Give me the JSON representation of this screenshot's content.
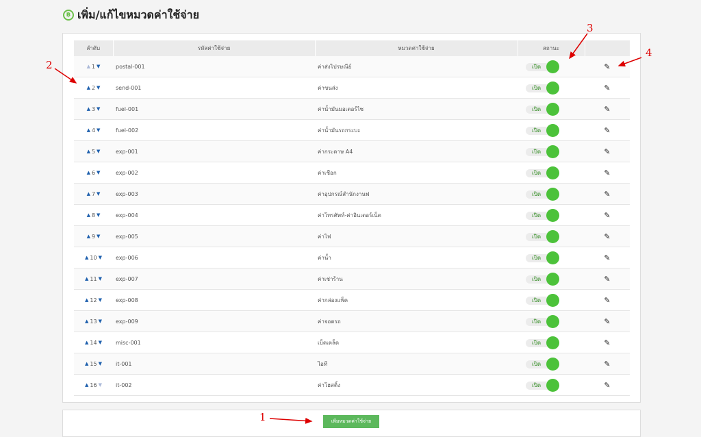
{
  "page": {
    "title": "เพิ่ม/แก้ไขหมวดค่าใช้จ่าย",
    "title_icon": "coin-icon"
  },
  "table": {
    "headers": {
      "order": "ลำดับ",
      "code": "รหัสค่าใช้จ่าย",
      "category": "หมวดค่าใช้จ่าย",
      "status": "สถานะ",
      "action": ""
    },
    "rows": [
      {
        "order": "1",
        "code": "postal-001",
        "category": "ค่าส่งไปรษณีย์",
        "status": "เปิด"
      },
      {
        "order": "2",
        "code": "send-001",
        "category": "ค่าขนส่ง",
        "status": "เปิด"
      },
      {
        "order": "3",
        "code": "fuel-001",
        "category": "ค่าน้ำมันมอเตอร์ไซ",
        "status": "เปิด"
      },
      {
        "order": "4",
        "code": "fuel-002",
        "category": "ค่าน้ำมันรถกระบะ",
        "status": "เปิด"
      },
      {
        "order": "5",
        "code": "exp-001",
        "category": "ค่ากระดาษ A4",
        "status": "เปิด"
      },
      {
        "order": "6",
        "code": "exp-002",
        "category": "ค่าเชือก",
        "status": "เปิด"
      },
      {
        "order": "7",
        "code": "exp-003",
        "category": "ค่าอุปกรณ์สำนักงานฟ",
        "status": "เปิด"
      },
      {
        "order": "8",
        "code": "exp-004",
        "category": "ค่าโทรศัพท์-ค่าอินเตอร์เน็ต",
        "status": "เปิด"
      },
      {
        "order": "9",
        "code": "exp-005",
        "category": "ค่าไฟ",
        "status": "เปิด"
      },
      {
        "order": "10",
        "code": "exp-006",
        "category": "ค่าน้ำ",
        "status": "เปิด"
      },
      {
        "order": "11",
        "code": "exp-007",
        "category": "ค่าเช่าร้าน",
        "status": "เปิด"
      },
      {
        "order": "12",
        "code": "exp-008",
        "category": "ค่ากล่องแพ็ค",
        "status": "เปิด"
      },
      {
        "order": "13",
        "code": "exp-009",
        "category": "ค่าจอดรถ",
        "status": "เปิด"
      },
      {
        "order": "14",
        "code": "misc-001",
        "category": "เบ็ดเตล็ด",
        "status": "เปิด"
      },
      {
        "order": "15",
        "code": "it-001",
        "category": "ไอที",
        "status": "เปิด"
      },
      {
        "order": "16",
        "code": "it-002",
        "category": "ค่าโฮสติ้ง",
        "status": "เปิด"
      }
    ]
  },
  "footer": {
    "add_button": "เพิ่มหมวดค่าใช้จ่าย"
  },
  "annotations": [
    "1",
    "2",
    "3",
    "4"
  ],
  "colors": {
    "accent_green": "#5cb85c",
    "toggle_green": "#4cc23a",
    "annotation_red": "#dd0000"
  }
}
